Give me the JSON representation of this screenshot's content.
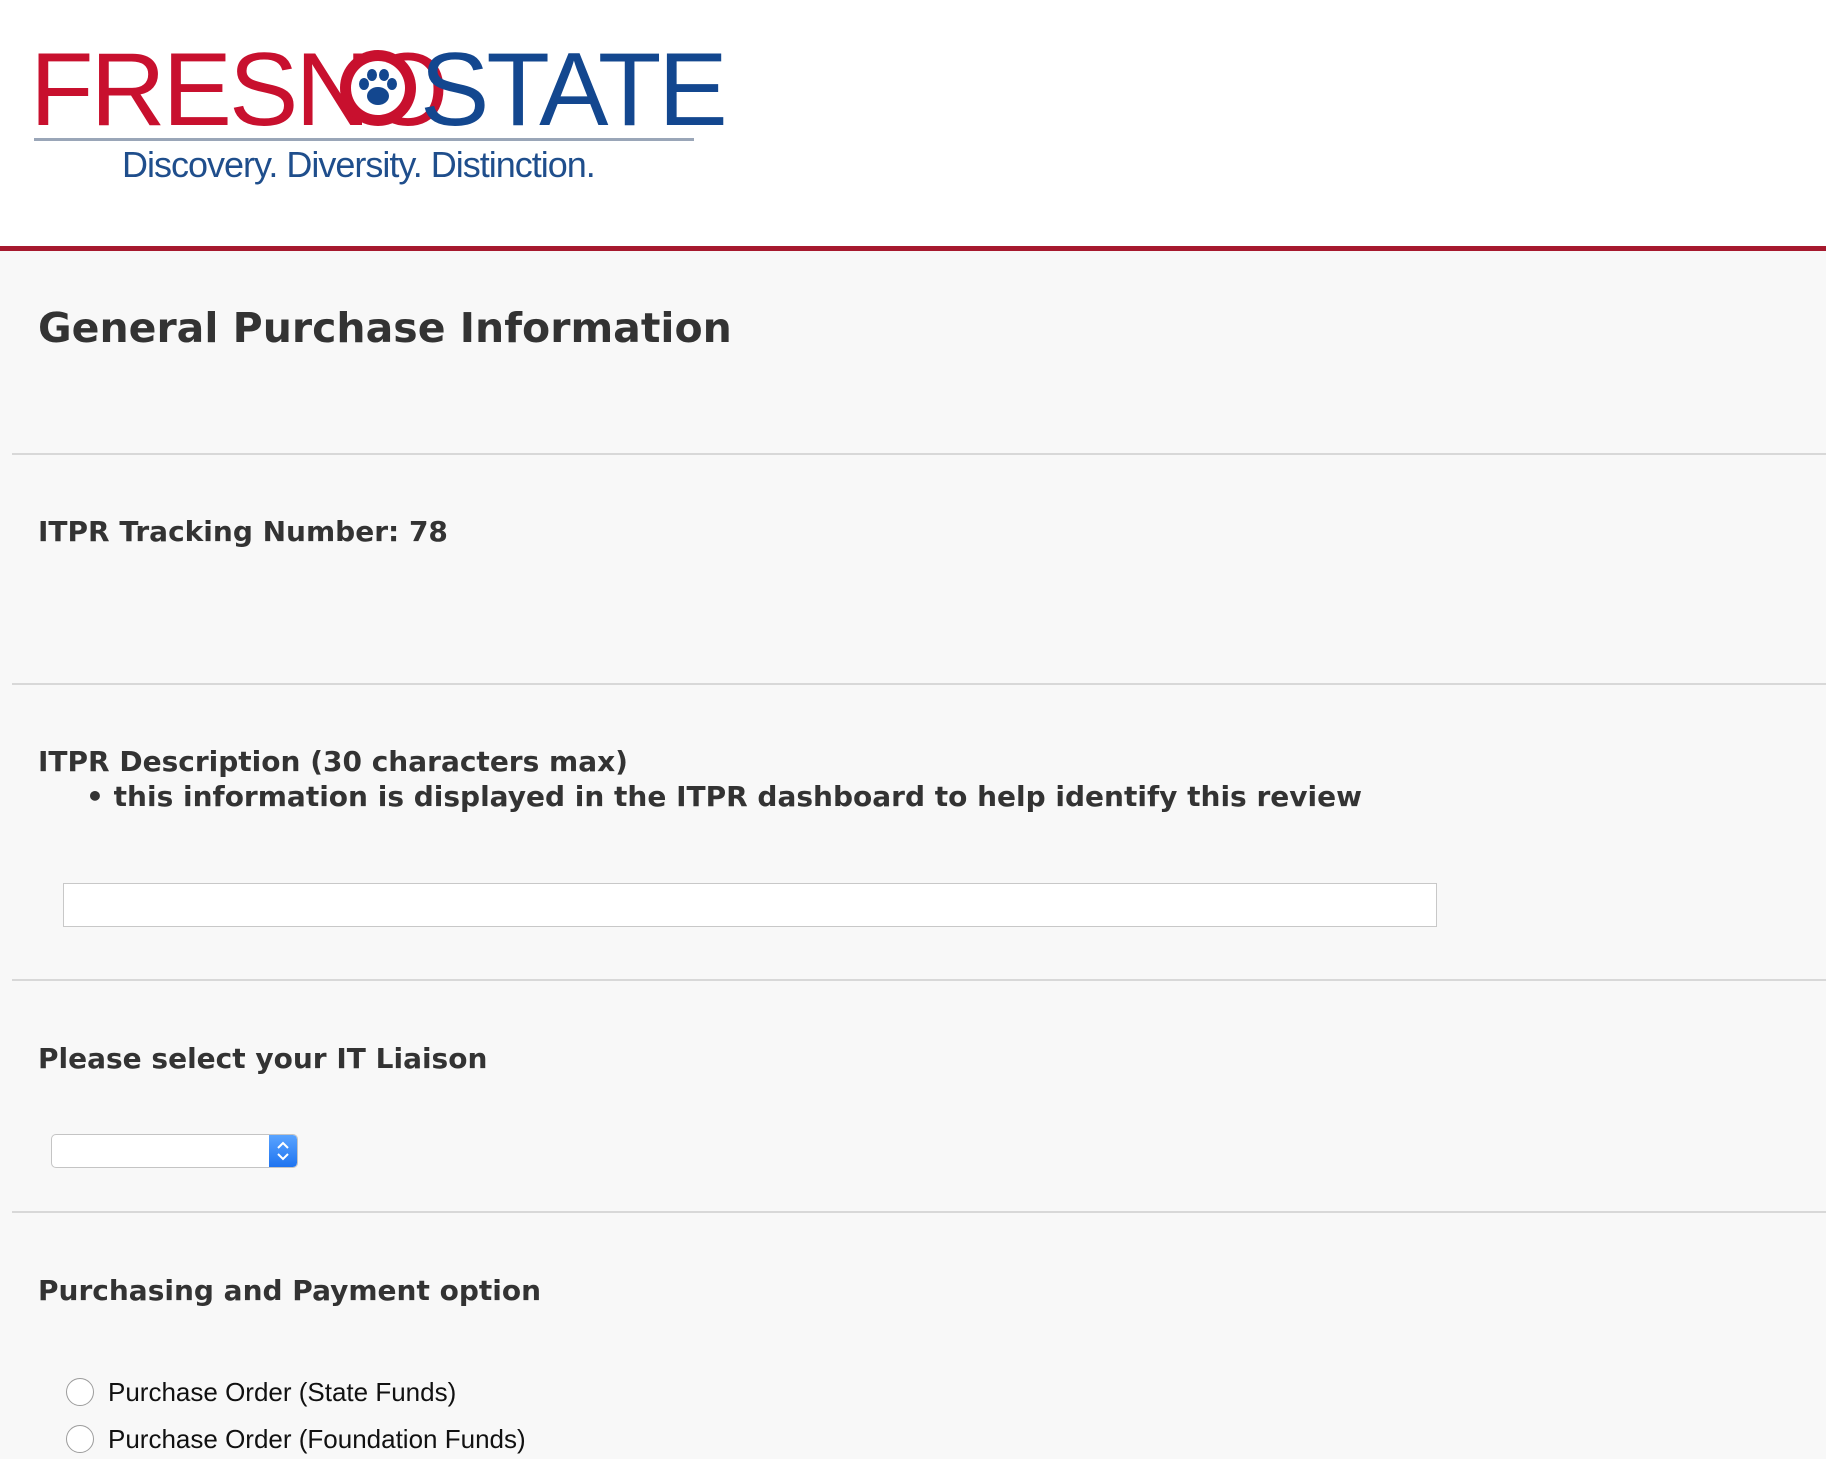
{
  "brand": {
    "word_left": "FRESNO",
    "word_right": "STATE",
    "tagline": "Discovery. Diversity. Distinction.",
    "colors": {
      "red": "#c8102e",
      "blue": "#13478f",
      "rule": "#a6192e"
    }
  },
  "page": {
    "title": "General Purchase Information"
  },
  "tracking": {
    "label": "ITPR Tracking Number: 78"
  },
  "description": {
    "label": "ITPR Description (30 characters max)",
    "bullet": "this information is displayed in the ITPR dashboard to help identify this review",
    "value": "",
    "placeholder": ""
  },
  "liaison": {
    "label": "Please select your IT Liaison",
    "selected": ""
  },
  "payment": {
    "label": "Purchasing and Payment option",
    "options": [
      {
        "label": "Purchase Order (State Funds)",
        "checked": false
      },
      {
        "label": "Purchase Order (Foundation Funds)",
        "checked": false
      }
    ]
  }
}
